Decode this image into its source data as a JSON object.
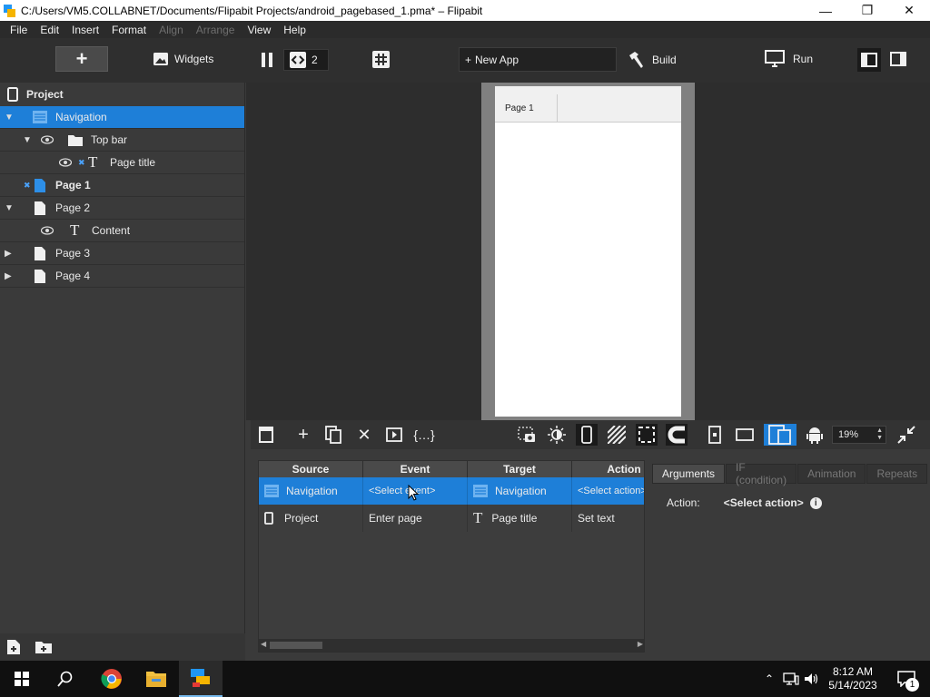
{
  "window": {
    "title": "C:/Users/VM5.COLLABNET/Documents/Flipabit Projects/android_pagebased_1.pma* – Flipabit"
  },
  "menu": [
    "File",
    "Edit",
    "Insert",
    "Format",
    "Align",
    "Arrange",
    "View",
    "Help"
  ],
  "menu_disabled": [
    "Align",
    "Arrange"
  ],
  "toolbar": {
    "widgets_label": "Widgets",
    "selection_count": "2",
    "new_app_label": "New App",
    "build_label": "Build",
    "run_label": "Run"
  },
  "tree": {
    "header": "Project",
    "items": [
      {
        "label": "Navigation"
      },
      {
        "label": "Top bar"
      },
      {
        "label": "Page title"
      },
      {
        "label": "Page 1"
      },
      {
        "label": "Page 2"
      },
      {
        "label": "Content"
      },
      {
        "label": "Page 3"
      },
      {
        "label": "Page 4"
      }
    ]
  },
  "canvas": {
    "page_title_text": "Page 1"
  },
  "canvas_toolbar": {
    "zoom": "19%"
  },
  "events": {
    "columns": [
      "Source",
      "Event",
      "Target",
      "Action"
    ],
    "rows": [
      {
        "source": "Navigation",
        "event": "<Select event>",
        "target": "Navigation",
        "action": "<Select action>"
      },
      {
        "source": "Project",
        "event": "Enter page",
        "target": "Page title",
        "action": "Set text"
      }
    ]
  },
  "props": {
    "tabs": [
      "Arguments",
      "IF (condition)",
      "Animation",
      "Repeats"
    ],
    "action_label": "Action:",
    "action_value": "<Select action>"
  },
  "taskbar": {
    "time": "8:12 AM",
    "date": "5/14/2023",
    "notification_count": "1"
  },
  "colors": {
    "accent": "#1e7fd8",
    "panel": "#3a3a3a",
    "canvas_bg": "#2d2d2d"
  }
}
